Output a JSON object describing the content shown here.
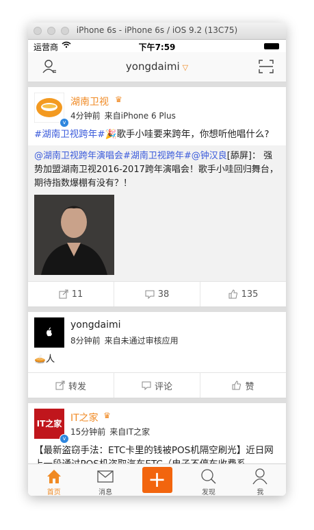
{
  "window": {
    "title": "iPhone 6s - iPhone 6s / iOS 9.2 (13C75)"
  },
  "status_bar": {
    "carrier": "运营商",
    "time": "下午7:59"
  },
  "nav": {
    "title": "yongdaimi",
    "left_icon": "user-friends-icon",
    "right_icon": "scan-icon"
  },
  "posts": [
    {
      "user": "湖南卫视",
      "time": "4分钟前",
      "source": "来自iPhone 6 Plus",
      "text_link": "#湖南卫视跨年#",
      "text_emoji": "🎉",
      "text_rest": "歌手小哇要来跨年，你想听他唱什么?",
      "quote_links": "@湖南卫视跨年演唱会#湖南卫视跨年#@钟汉良",
      "quote_text": "[舔屏]：  强势加盟湖南卫视2016-2017跨年演唱会！歌手小哇回归舞台，期待指数爆棚有没有？！",
      "repost": "11",
      "comment": "38",
      "like": "135"
    },
    {
      "user": "yongdaimi",
      "time": "8分钟前",
      "source": "来自未通过审核应用",
      "text": "🥧人",
      "repost": "转发",
      "comment": "评论",
      "like": "赞"
    },
    {
      "user": "IT之家",
      "time": "15分钟前",
      "source": "来自IT之家",
      "avatar_text": "IT之家",
      "text": "【最新盗窃手法：ETC卡里的钱被POS机隔空刷光】近日网上一段通过POS机盗取汽车ETC（电子不停车收费系"
    }
  ],
  "tabbar": [
    {
      "label": "首页",
      "icon": "home-icon"
    },
    {
      "label": "消息",
      "icon": "message-icon"
    },
    {
      "label": "",
      "icon": "plus-icon"
    },
    {
      "label": "发现",
      "icon": "discover-icon"
    },
    {
      "label": "我",
      "icon": "profile-icon"
    }
  ],
  "colors": {
    "accent": "#f08a24",
    "link": "#3b5bdb",
    "compose": "#f2650e"
  }
}
